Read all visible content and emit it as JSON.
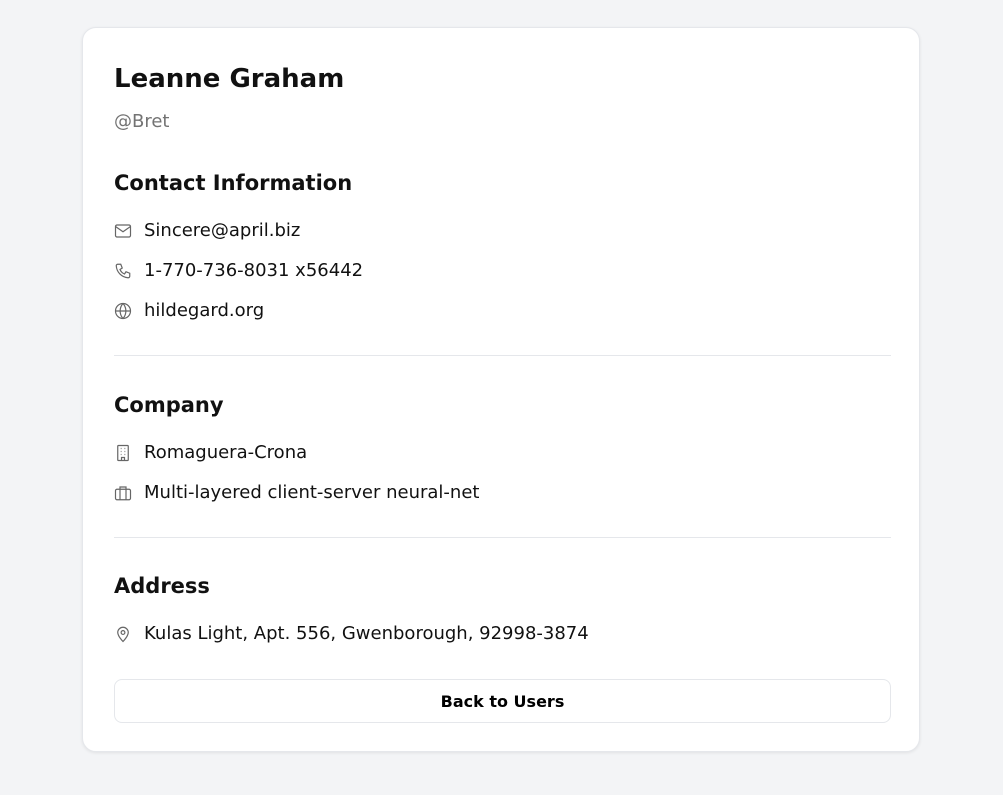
{
  "user": {
    "name": "Leanne Graham",
    "username": "@Bret"
  },
  "contact": {
    "title": "Contact Information",
    "email": "Sincere@april.biz",
    "phone": "1-770-736-8031 x56442",
    "website": "hildegard.org"
  },
  "company": {
    "title": "Company",
    "name": "Romaguera-Crona",
    "catchphrase": "Multi-layered client-server neural-net"
  },
  "address": {
    "title": "Address",
    "full": "Kulas Light, Apt. 556, Gwenborough, 92998-3874"
  },
  "actions": {
    "back_label": "Back to Users"
  }
}
